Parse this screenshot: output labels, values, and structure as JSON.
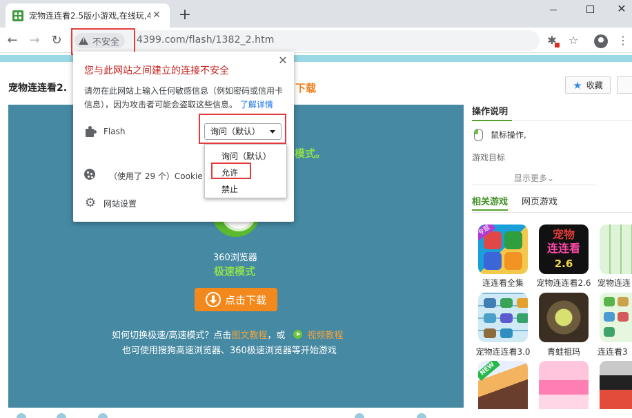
{
  "window": {
    "tab_title": "宠物连连看2.5版小游戏,在线玩,4",
    "tab_close_glyph": "✕",
    "new_tab_glyph": "+",
    "close_glyph": "✕"
  },
  "toolbar": {
    "back_glyph": "←",
    "forward_glyph": "→",
    "reload_glyph": "↻",
    "security_text": "不安全",
    "url": "4399.com/flash/1382_2.htm",
    "star_glyph": "☆",
    "menu_glyph": "⋮",
    "ext_glyph": "✱"
  },
  "page": {
    "game_title": "宠物连连看2.",
    "download_link": "下载",
    "favorite_label": "收藏",
    "favorite_glyph": "★",
    "mode_text": "速模式。",
    "browser_name": "360浏览器",
    "browser_mode": "极速模式",
    "download_button": "点击下载",
    "help_line1_prefix": "如何切换极速/高速模式？点击",
    "help_line1_link1": "图文教程",
    "help_line1_mid": "，或",
    "help_line1_link2": "视频教程",
    "help_line2": "也可使用搜狗高速浏览器、360极速浏览器等开始游戏"
  },
  "sidebar": {
    "heading": "操作说明",
    "mouse_text": "鼠标操作,",
    "goal_text": "游戏目标",
    "show_more": "显示更多",
    "show_more_glyph": "⌄",
    "tabs": [
      {
        "label": "相关游戏"
      },
      {
        "label": "网页游戏"
      }
    ],
    "games": [
      {
        "label": "连连看全集",
        "badge": "专题"
      },
      {
        "label": "宠物连连看2.6",
        "art_line1": "宠物",
        "art_line2": "连连看",
        "art_line3": "2.6"
      },
      {
        "label": "宠物连连"
      },
      {
        "label": "宠物连连看3.0"
      },
      {
        "label": "青蛙祖玛"
      },
      {
        "label": "连连看3"
      },
      {
        "label": "",
        "badge": "NEW"
      },
      {
        "label": ""
      },
      {
        "label": ""
      }
    ]
  },
  "popup": {
    "close_glyph": "✕",
    "title": "您与此网站之间建立的连接不安全",
    "description": "请勿在此网站上输入任何敏感信息（例如密码或信用卡信息），因为攻击者可能会盗取这些信息。",
    "learn_more": "了解详情",
    "flash_label": "Flash",
    "flash_selected": "询问（默认）",
    "cookie_label": "（使用了 29 个）Cookie",
    "site_settings": "网站设置",
    "gear_glyph": "⚙",
    "options": [
      "询问（默认）",
      "允许",
      "禁止"
    ]
  },
  "colors": {
    "accent_red": "#e33b3b",
    "warning_title": "#c5221f",
    "link_blue": "#1a73e8",
    "game_bg": "#4589a3",
    "green": "#8ee04e",
    "orange": "#f3891d"
  }
}
